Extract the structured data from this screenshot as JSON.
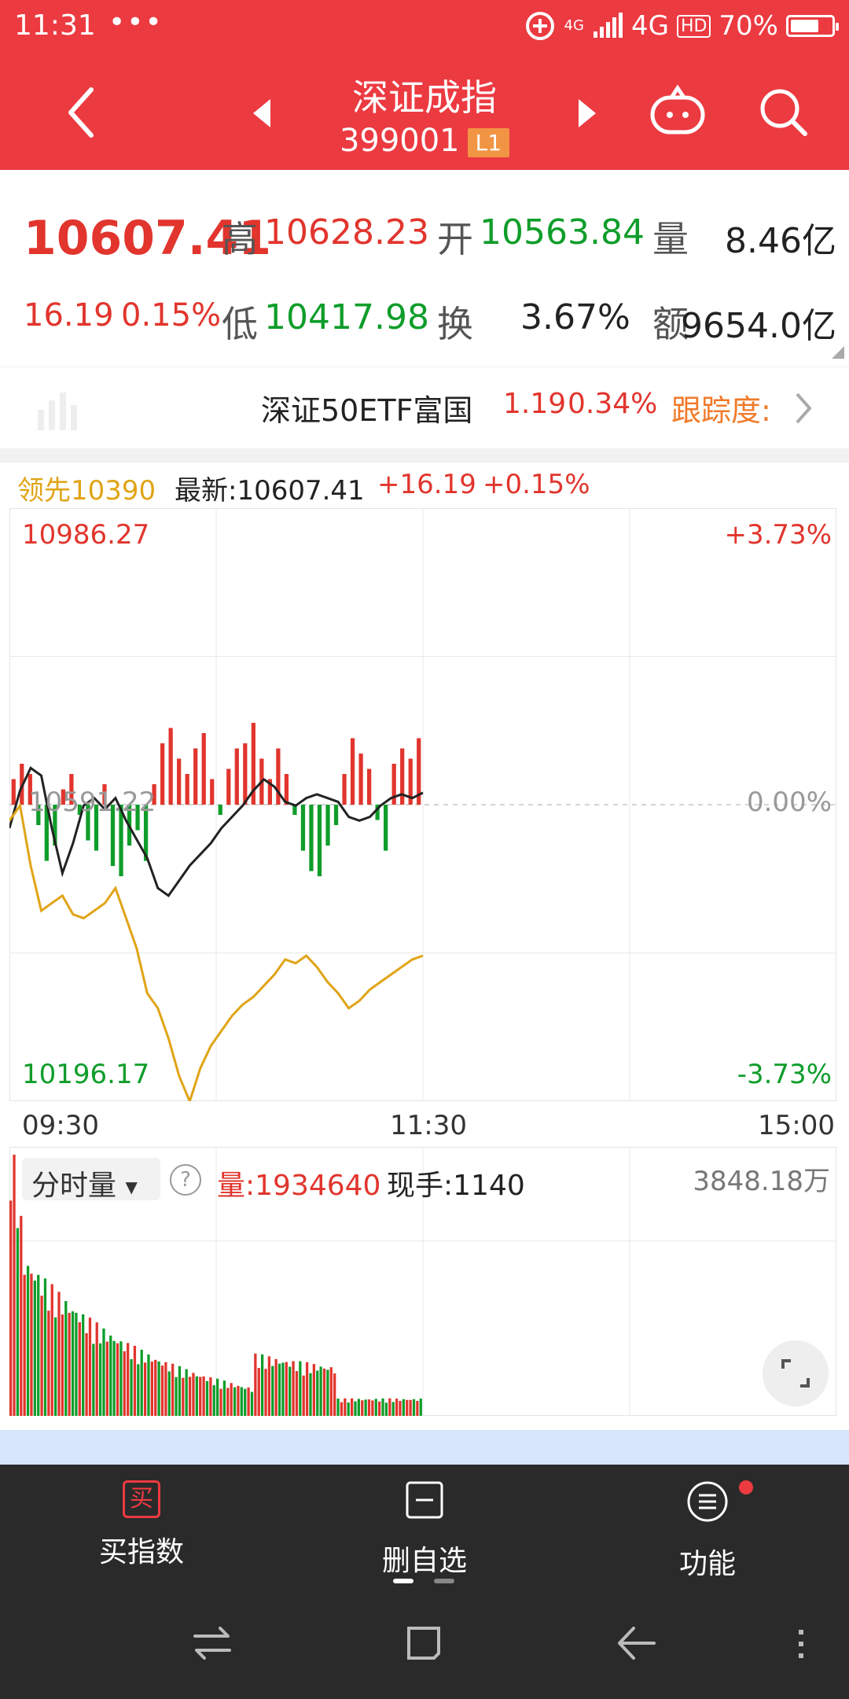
{
  "status_bar": {
    "time": "11:31",
    "dots": "•••",
    "network_small": "4G",
    "network": "4G",
    "hd": "HD",
    "battery": "70%",
    "battery_level": 0.7
  },
  "header": {
    "title": "深证成指",
    "code": "399001",
    "badge": "L1"
  },
  "quote": {
    "last": "10607.41",
    "change": "16.19",
    "change_pct": "0.15%",
    "high_label": "高",
    "high": "10628.23",
    "open_label": "开",
    "open": "10563.84",
    "volume_label": "量",
    "volume": "8.46亿",
    "low_label": "低",
    "low": "10417.98",
    "turnover_label": "换",
    "turnover": "3.67%",
    "amount_label": "额",
    "amount": "9654.0亿"
  },
  "etf": {
    "name": "深证50ETF富国",
    "price": "1.19",
    "pct": "0.34%",
    "track_label": "跟踪度:"
  },
  "chart_legend": {
    "lead": "领先10390",
    "latest_label": "最新:10607.41",
    "change": "+16.19",
    "pct": "+0.15%"
  },
  "chart_axis": {
    "top_left": "10986.27",
    "top_right": "+3.73%",
    "mid_left": "10591.22",
    "mid_right": "0.00%",
    "bottom_left": "10196.17",
    "bottom_right": "-3.73%",
    "t_start": "09:30",
    "t_mid": "11:30",
    "t_end": "15:00"
  },
  "volume_panel": {
    "selector": "分时量",
    "volume_label": "量:1934640",
    "current_label": "现手:1140",
    "max": "3848.18万"
  },
  "bottom_bar": {
    "buy_icon": "买",
    "buy_label": "买指数",
    "delete_label": "删自选",
    "func_label": "功能"
  },
  "colors": {
    "brand_red": "#ec3a41",
    "up": "#e1352d",
    "down": "#0f9d2a",
    "lead_line": "#e0a416",
    "price_line": "#222222",
    "track_orange": "#f07a2a"
  },
  "chart_data": {
    "type": "line",
    "x": [
      "09:30",
      "11:30",
      "15:00"
    ],
    "y_range": [
      10196.17,
      10986.27
    ],
    "y_pct_range": [
      -3.73,
      3.73
    ],
    "pre_close": 10591.22,
    "series": [
      {
        "values": [
          10560,
          10610,
          10640,
          10630,
          10560,
          10500,
          10540,
          10590,
          10600,
          10585,
          10600,
          10570,
          10545,
          10520,
          10480,
          10470,
          10490,
          10510,
          10525,
          10540,
          10560,
          10575,
          10590,
          10610,
          10625,
          10615,
          10595,
          10590,
          10600,
          10605,
          10600,
          10595,
          10575,
          10570,
          10575,
          10590,
          10600,
          10605,
          10600,
          10607
        ]
      },
      {
        "values": [
          10570,
          10590,
          10510,
          10450,
          10460,
          10470,
          10445,
          10440,
          10450,
          10460,
          10480,
          10440,
          10400,
          10340,
          10320,
          10280,
          10230,
          10196,
          10240,
          10270,
          10290,
          10310,
          10325,
          10335,
          10350,
          10365,
          10385,
          10380,
          10390,
          10375,
          10355,
          10340,
          10320,
          10330,
          10345,
          10355,
          10365,
          10375,
          10385,
          10390
        ]
      }
    ],
    "bar_deltas": [
      25,
      40,
      30,
      -20,
      -55,
      -40,
      15,
      30,
      -10,
      -35,
      -45,
      20,
      -60,
      -70,
      -40,
      -25,
      -55,
      20,
      60,
      75,
      45,
      30,
      55,
      70,
      25,
      -10,
      35,
      55,
      60,
      80,
      45,
      25,
      55,
      30,
      -10,
      -45,
      -65,
      -70,
      -40,
      -20,
      30,
      65,
      50,
      35,
      -15,
      -45,
      40,
      55,
      45,
      65
    ]
  }
}
